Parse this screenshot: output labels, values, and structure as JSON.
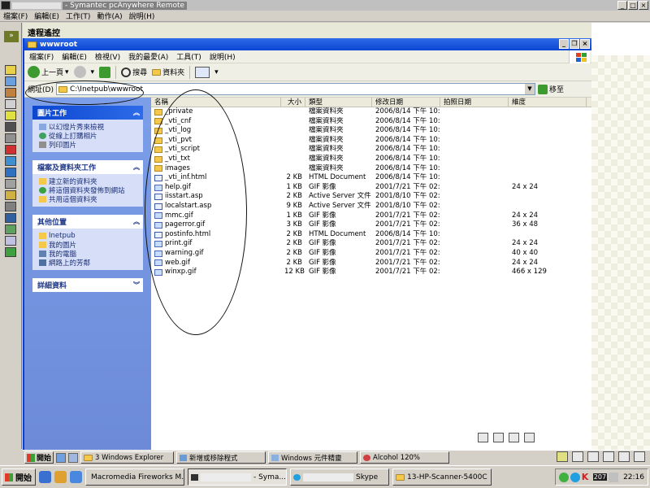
{
  "outer_window": {
    "title": "- Symantec pcAnywhere Remote",
    "menu": [
      "檔案(F)",
      "編輯(E)",
      "工作(T)",
      "動作(A)",
      "說明(H)"
    ],
    "controls": [
      "_",
      "□",
      "×"
    ],
    "expand_glyph": "»"
  },
  "remote_header": "遠程遙控",
  "explorer": {
    "title": "wwwroot",
    "title_controls": [
      "_",
      "❐",
      "×"
    ],
    "menu": [
      "檔案(F)",
      "編輯(E)",
      "檢視(V)",
      "我的最愛(A)",
      "工具(T)",
      "說明(H)"
    ],
    "toolbar": {
      "back": "上一頁",
      "search": "搜尋",
      "folders": "資料夾"
    },
    "address": {
      "label": "網址(D)",
      "value": "C:\\Inetpub\\wwwroot",
      "go": "移至"
    },
    "tasks": [
      {
        "title": "圖片工作",
        "items": [
          "以幻燈片秀來檢視",
          "從線上訂購相片",
          "列印圖片"
        ]
      },
      {
        "title": "檔案及資料夾工作",
        "items": [
          "建立新的資料夾",
          "將這個資料夾發佈到網站",
          "共用這個資料夾"
        ]
      },
      {
        "title": "其他位置",
        "items": [
          "Inetpub",
          "我的圖片",
          "我的電腦",
          "網路上的芳鄰"
        ]
      },
      {
        "title": "詳細資料",
        "items": []
      }
    ],
    "columns": [
      "名稱",
      "大小",
      "類型",
      "修改日期",
      "拍照日期",
      "維度"
    ],
    "files": [
      {
        "name": "_private",
        "size": "",
        "type": "檔案資料夾",
        "modified": "2006/8/14 下午 10:13",
        "dim": "",
        "icon": "folder"
      },
      {
        "name": "_vti_cnf",
        "size": "",
        "type": "檔案資料夾",
        "modified": "2006/8/14 下午 10:13",
        "dim": "",
        "icon": "folder"
      },
      {
        "name": "_vti_log",
        "size": "",
        "type": "檔案資料夾",
        "modified": "2006/8/14 下午 10:13",
        "dim": "",
        "icon": "folder"
      },
      {
        "name": "_vti_pvt",
        "size": "",
        "type": "檔案資料夾",
        "modified": "2006/8/14 下午 10:13",
        "dim": "",
        "icon": "folder"
      },
      {
        "name": "_vti_script",
        "size": "",
        "type": "檔案資料夾",
        "modified": "2006/8/14 下午 10:13",
        "dim": "",
        "icon": "folder"
      },
      {
        "name": "_vti_txt",
        "size": "",
        "type": "檔案資料夾",
        "modified": "2006/8/14 下午 10:13",
        "dim": "",
        "icon": "folder"
      },
      {
        "name": "images",
        "size": "",
        "type": "檔案資料夾",
        "modified": "2006/8/14 下午 10:13",
        "dim": "",
        "icon": "folder"
      },
      {
        "name": "_vti_inf.html",
        "size": "2 KB",
        "type": "HTML Document",
        "modified": "2006/8/14 下午 10:13",
        "dim": "",
        "icon": "doc"
      },
      {
        "name": "help.gif",
        "size": "1 KB",
        "type": "GIF 影像",
        "modified": "2001/7/21 下午 02:22",
        "dim": "24 x 24",
        "icon": "gif"
      },
      {
        "name": "iisstart.asp",
        "size": "2 KB",
        "type": "Active Server 文件",
        "modified": "2001/8/10 下午 02:19",
        "dim": "",
        "icon": "doc"
      },
      {
        "name": "localstart.asp",
        "size": "9 KB",
        "type": "Active Server 文件",
        "modified": "2001/8/10 下午 02:19",
        "dim": "",
        "icon": "doc"
      },
      {
        "name": "mmc.gif",
        "size": "1 KB",
        "type": "GIF 影像",
        "modified": "2001/7/21 下午 02:22",
        "dim": "24 x 24",
        "icon": "gif"
      },
      {
        "name": "pagerror.gif",
        "size": "3 KB",
        "type": "GIF 影像",
        "modified": "2001/7/21 下午 02:22",
        "dim": "36 x 48",
        "icon": "gif"
      },
      {
        "name": "postinfo.html",
        "size": "2 KB",
        "type": "HTML Document",
        "modified": "2006/8/14 下午 10:13",
        "dim": "",
        "icon": "doc"
      },
      {
        "name": "print.gif",
        "size": "2 KB",
        "type": "GIF 影像",
        "modified": "2001/7/21 下午 02:22",
        "dim": "24 x 24",
        "icon": "gif"
      },
      {
        "name": "warning.gif",
        "size": "2 KB",
        "type": "GIF 影像",
        "modified": "2001/7/21 下午 02:22",
        "dim": "40 x 40",
        "icon": "gif"
      },
      {
        "name": "web.gif",
        "size": "2 KB",
        "type": "GIF 影像",
        "modified": "2001/7/21 下午 02:22",
        "dim": "24 x 24",
        "icon": "gif"
      },
      {
        "name": "winxp.gif",
        "size": "12 KB",
        "type": "GIF 影像",
        "modified": "2001/7/21 下午 02:22",
        "dim": "466 x 129",
        "icon": "gif"
      }
    ]
  },
  "remote_taskbar": {
    "start": "開始",
    "buttons": [
      "3 Windows Explorer",
      "新增或移除程式",
      "Windows 元件精靈",
      "Alcohol 120%"
    ]
  },
  "local_taskbar": {
    "start": "開始",
    "buttons": [
      "Macromedia Fireworks M...",
      "- Syma...",
      "Skype",
      "13-HP-Scanner-5400C"
    ],
    "tray_badge": "207",
    "clock": "22:16"
  }
}
